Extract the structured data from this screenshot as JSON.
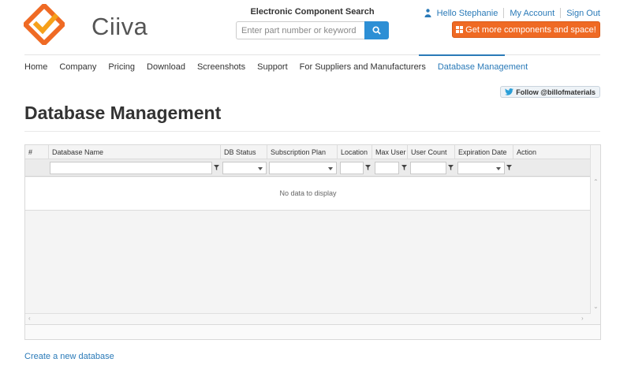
{
  "brand": {
    "name": "Ciiva",
    "accent": "#ef6a24",
    "logo_colors": [
      "#ef6a24",
      "#f6a01a"
    ]
  },
  "search": {
    "title": "Electronic Component Search",
    "placeholder": "Enter part number or keyword",
    "button_icon": "search-icon"
  },
  "user": {
    "greeting": "Hello Stephanie",
    "account": "My Account",
    "signout": "Sign Out",
    "icon": "person-icon"
  },
  "promo": {
    "label": "Get more components and space!",
    "icon": "grid-icon"
  },
  "nav": {
    "items": [
      "Home",
      "Company",
      "Pricing",
      "Download",
      "Screenshots",
      "Support",
      "For Suppliers and Manufacturers",
      "Database Management"
    ],
    "active": "Database Management"
  },
  "twitter": {
    "label": "Follow @billofmaterials",
    "icon": "twitter-bird-icon"
  },
  "page": {
    "title": "Database Management"
  },
  "grid": {
    "columns": [
      "#",
      "Database Name",
      "DB Status",
      "Subscription Plan",
      "Location",
      "Max User",
      "User Count",
      "Expiration Date",
      "Action"
    ],
    "empty_text": "No data to display",
    "rows": []
  },
  "footer": {
    "create_link": "Create a new database"
  }
}
